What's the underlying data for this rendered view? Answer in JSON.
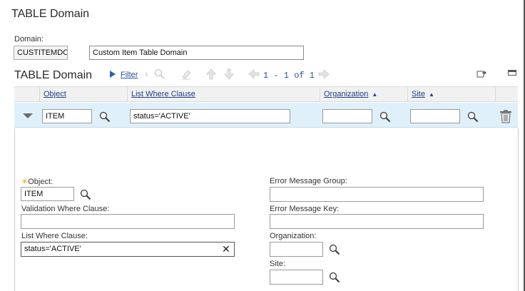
{
  "header": {
    "title": "TABLE Domain"
  },
  "domain": {
    "label": "Domain:",
    "code": "CUSTITEMDO",
    "description": "Custom Item Table Domain"
  },
  "section": {
    "title": "TABLE Domain",
    "filter_label": "Filter",
    "pager_text": "1 - 1 of 1"
  },
  "table": {
    "columns": [
      "Object",
      "List Where Clause",
      "Organization",
      "Site"
    ],
    "rows": [
      {
        "object": "ITEM",
        "list_where_clause": "status='ACTIVE'",
        "organization": "",
        "site": ""
      }
    ]
  },
  "detail": {
    "object_label": "Object:",
    "object_value": "ITEM",
    "validation_label": "Validation Where Clause:",
    "validation_value": "",
    "list_where_label": "List Where Clause:",
    "list_where_value": "status='ACTIVE'",
    "error_group_label": "Error Message Group:",
    "error_group_value": "",
    "error_key_label": "Error Message Key:",
    "error_key_value": "",
    "organization_label": "Organization:",
    "organization_value": "",
    "site_label": "Site:",
    "site_value": ""
  },
  "colors": {
    "accent": "#1d3f86",
    "selected_row": "#dff0fb",
    "header_row": "#f1f1f1",
    "required_star": "#e2a31a"
  },
  "icons": [
    "magnifier-icon",
    "play-arrow-icon",
    "chevron-right-icon",
    "eraser-icon",
    "arrow-up-icon",
    "arrow-down-icon",
    "arrow-left-icon",
    "arrow-right-icon",
    "download-icon",
    "collapse-icon",
    "chevron-down-icon",
    "trash-icon",
    "clear-icon"
  ]
}
